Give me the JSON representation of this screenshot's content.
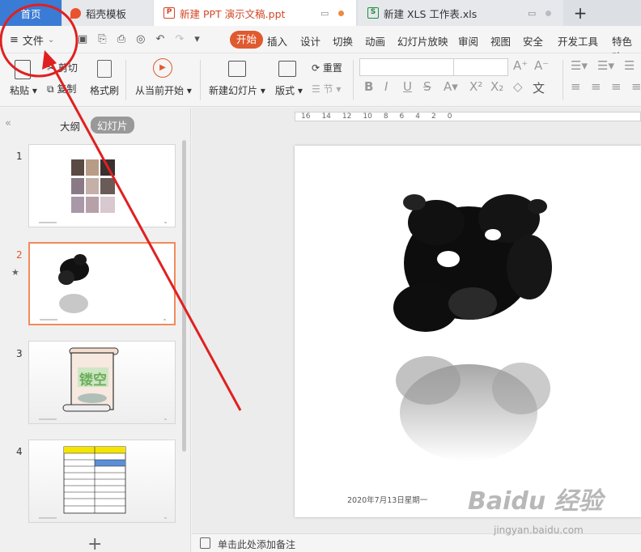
{
  "tabs": {
    "home": "首页",
    "straw": "稻壳模板",
    "ppt": "新建 PPT 演示文稿.ppt",
    "xls": "新建 XLS 工作表.xls",
    "add": "+"
  },
  "menu": {
    "file": "文件",
    "items": [
      "开始",
      "插入",
      "设计",
      "切换",
      "动画",
      "幻灯片放映",
      "审阅",
      "视图",
      "安全",
      "开发工具",
      "特色功"
    ]
  },
  "ribbon": {
    "paste": "粘贴",
    "cut": "剪切",
    "copy": "复制",
    "format_painter": "格式刷",
    "play_from_current": "从当前开始",
    "new_slide": "新建幻灯片",
    "layout": "版式",
    "reset": "重置",
    "section": "节"
  },
  "panel": {
    "outline": "大纲",
    "slides": "幻灯片",
    "slide_numbers": [
      "1",
      "2",
      "3",
      "4"
    ],
    "add": "+",
    "slide3_title": "镂空"
  },
  "ruler_ticks": [
    "16",
    "14",
    "12",
    "10",
    "8",
    "6",
    "4",
    "2",
    "0"
  ],
  "slide": {
    "date": "2020年7月13日星期一"
  },
  "notes": {
    "placeholder": "单击此处添加备注"
  },
  "watermark": {
    "brand": "Baidu 经验",
    "url": "jingyan.baidu.com"
  },
  "colors": {
    "accent": "#e05a2f",
    "home_tab": "#3a7bd5",
    "annotation": "#e02020",
    "selected_border": "#f18a5c"
  }
}
